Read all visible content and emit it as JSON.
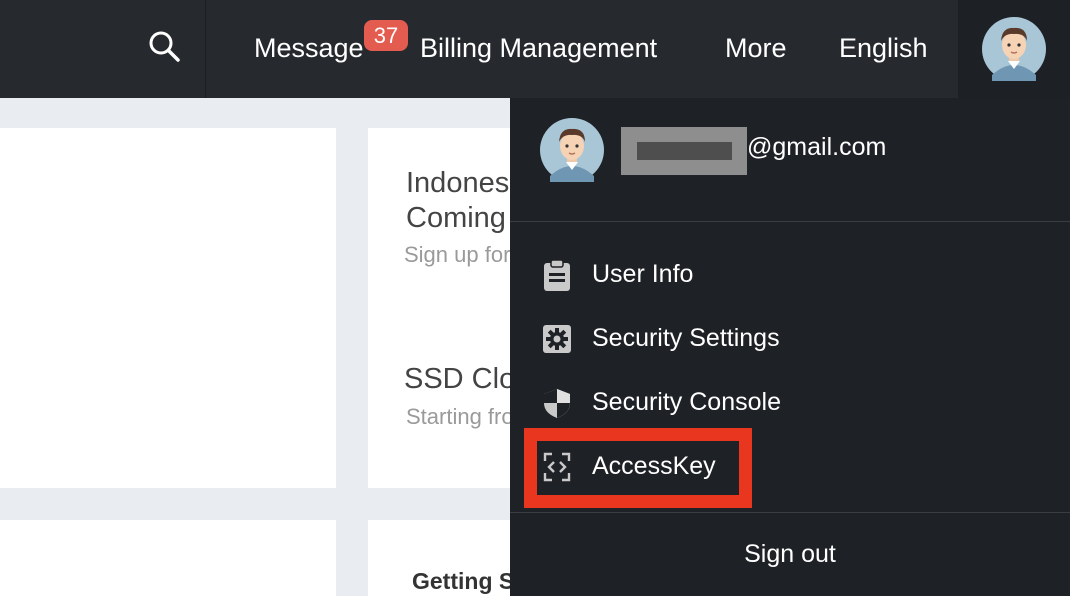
{
  "topbar": {
    "message_label": "Message",
    "message_badge": "37",
    "billing_label": "Billing Management",
    "more_label": "More",
    "language_label": "English"
  },
  "cards": {
    "card2_title_line1": "Indones",
    "card2_title_line2": "Coming",
    "card2_subtitle": "Sign up for",
    "card2_title2": "SSD Clo",
    "card2_subtitle2": "Starting fro",
    "card4_title": "Getting S"
  },
  "user_menu": {
    "email_suffix": "@gmail.com",
    "items": [
      {
        "label": "User Info",
        "icon": "clipboard-icon"
      },
      {
        "label": "Security Settings",
        "icon": "gear-icon"
      },
      {
        "label": "Security Console",
        "icon": "shield-icon"
      },
      {
        "label": "AccessKey",
        "icon": "code-key-icon"
      }
    ],
    "sign_out_label": "Sign out"
  },
  "colors": {
    "topbar_bg": "#262a2f",
    "dropdown_bg": "#1e2125",
    "badge": "#e45b4f",
    "highlight": "#e8371e"
  }
}
